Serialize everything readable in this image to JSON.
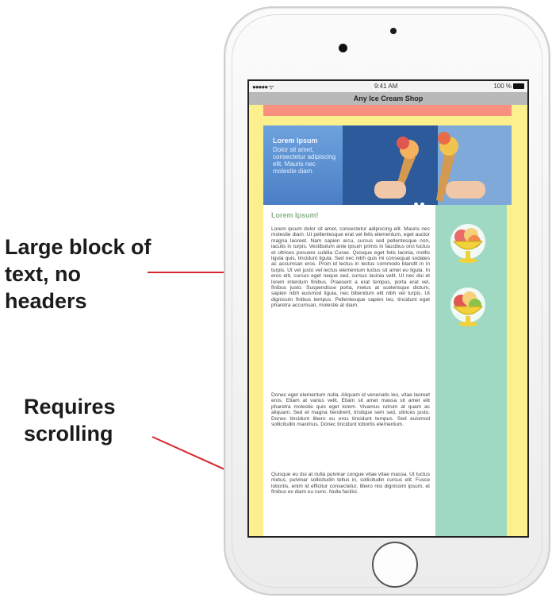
{
  "annotations": {
    "label_1": "Large block of text, no headers",
    "label_2": "Requires scrolling"
  },
  "statusbar": {
    "signal": "●●●●● ᯤ",
    "time": "9:41 AM",
    "battery": "100 %"
  },
  "app": {
    "title": "Any Ice Cream Shop"
  },
  "hero": {
    "title": "Lorem Ipsum",
    "text": "Dolor sit amet, consectetur adipiscing elit. Mauris nec molestie diam."
  },
  "main": {
    "heading": "Lorem Ipsum!",
    "paragraph_1": "Lorem ipsum dolor sit amet, consectetur adipiscing elit. Mauris nec molestie diam. Ut pellentesque erat vel felis elementum, eget auctor magna laoreet. Nam sapien arcu, cursus sed pellentesque non, iaculis in turpis. Vestibulum ante ipsum primis in faucibus orci luctus et ultrices posuere cubilia Curae. Quisque eget felis lacinia, mollis ligula quis, tincidunt ligula. Sed nec nibh quis mi consequat sodales ac accumsan eros. Proin id lectus in lectus commodo blandit in in turpis. Ut vel justo vel lectus elementum luctus sit amet eu ligula. In eros elit, cursus eget neque sed, cursus lacinia velit. Ut nec dui et lorem interdum finibus. Praesent a erat tempus, porta erat vel, finibus justo. Suspendisse porta, metus at scelerisque dictum, sapien nibh euismod ligula, nec bibendum elit nibh vel turpis. Ut dignissim finibus tempus. Pellentesque sapien leo, tincidunt eget pharetra accumsan, molestie at diam.",
    "paragraph_2": "Donec eget elementum nulla. Aliquam id venenatis leo, vitae laoreet eros. Etiam at varius velit. Etiam sit amet massa sit amet elit pharetra molestie quis eget lorem. Vivamus rutrum at quam ac aliquam. Sed et magna hendrerit, tristique sem sed, ultrices justo. Donec tincidunt libero eu eros tincidunt tempus. Sed euismod sollicitudin maximus. Donec tincidunt lobortis elementum.",
    "paragraph_3": "Quisque eu dui at nulla pulvinar congue vitae vitae massa. Ut luctus metus, pulvinar sollicitudin tellus in, sollicitudin cursus elit. Fusce lobortis, enim id efficitur consectetur, libero nisi dignissim ipsum, et finibus ex diam eu nunc. Nulla facilisi."
  },
  "colors": {
    "page_bg": "#fbf08d",
    "banner": "#f7907f",
    "sidebar": "#9fd9c4",
    "arrow": "#d8262e"
  }
}
